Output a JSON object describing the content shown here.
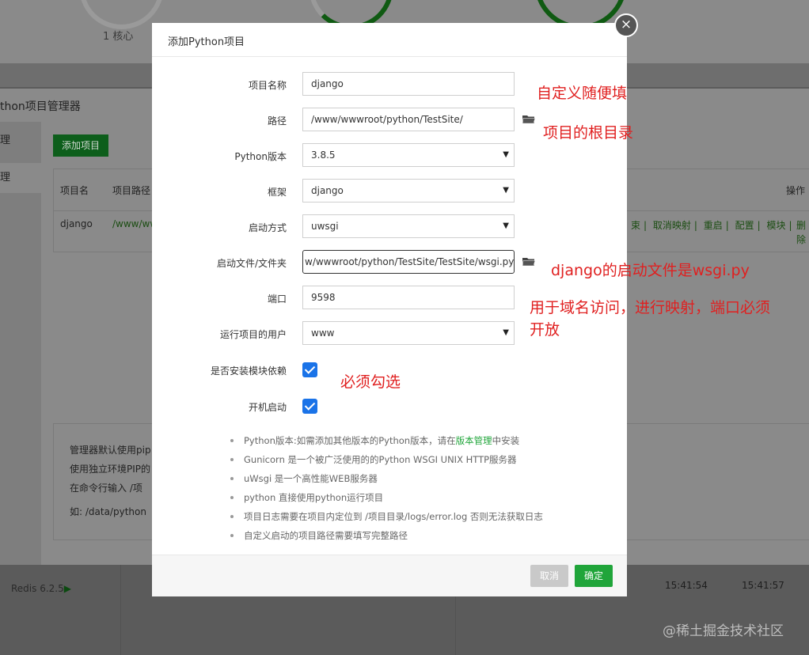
{
  "background": {
    "core_label": "1 核心",
    "manager_title": "thon项目管理器",
    "sidebar": [
      "理",
      "理"
    ],
    "add_button": "添加项目",
    "table": {
      "headers": [
        "项目名",
        "项目路径",
        "操作"
      ],
      "row": {
        "name": "django",
        "path": "/www/ww",
        "ops": [
          "束",
          "取消映射",
          "重启",
          "配置",
          "模块"
        ],
        "delete": "删除"
      }
    },
    "note_lines": [
      "管理器默认使用pip",
      "使用独立环境PIP的",
      "在命令行输入 /项",
      "如: /data/python"
    ],
    "redis": "Redis 6.2.5",
    "times": [
      "15:41:54",
      "15:41:57"
    ],
    "watermark": "@稀土掘金技术社区"
  },
  "modal": {
    "title": "添加Python项目",
    "close_icon": "close-icon",
    "fields": {
      "name": {
        "label": "项目名称",
        "value": "django"
      },
      "path": {
        "label": "路径",
        "value": "/www/wwwroot/python/TestSite/"
      },
      "python_version": {
        "label": "Python版本",
        "value": "3.8.5"
      },
      "framework": {
        "label": "框架",
        "value": "django"
      },
      "start_method": {
        "label": "启动方式",
        "value": "uwsgi"
      },
      "start_file": {
        "label": "启动文件/文件夹",
        "value": "w/wwwroot/python/TestSite/TestSite/wsgi.py"
      },
      "port": {
        "label": "端口",
        "value": "9598"
      },
      "run_user": {
        "label": "运行项目的用户",
        "value": "www"
      },
      "install_deps": {
        "label": "是否安装模块依赖",
        "checked": true
      },
      "autostart": {
        "label": "开机启动",
        "checked": true
      }
    },
    "tips": {
      "t1_before": "Python版本:如需添加其他版本的Python版本，请在",
      "t1_link": "版本管理",
      "t1_after": "中安装",
      "t2": "Gunicorn 是一个被广泛使用的的Python WSGI UNIX HTTP服务器",
      "t3": "uWsgi 是一个高性能WEB服务器",
      "t4": "python 直接使用python运行项目",
      "t5": "项目日志需要在项目内定位到 /项目目录/logs/error.log 否则无法获取日志",
      "t6": "自定义启动的项目路径需要填写完整路径"
    },
    "buttons": {
      "cancel": "取消",
      "ok": "确定"
    }
  },
  "annotations": {
    "a1": "自定义随便填",
    "a2": "项目的根目录",
    "a3": "django的启动文件是wsgi.py",
    "a4_line1": "用于域名访问，进行映射，端口必须",
    "a4_line2": "开放",
    "a5": "必须勾选"
  },
  "colors": {
    "accent": "#20a53a",
    "annotation": "#e02020",
    "checkbox": "#1a73e8"
  }
}
